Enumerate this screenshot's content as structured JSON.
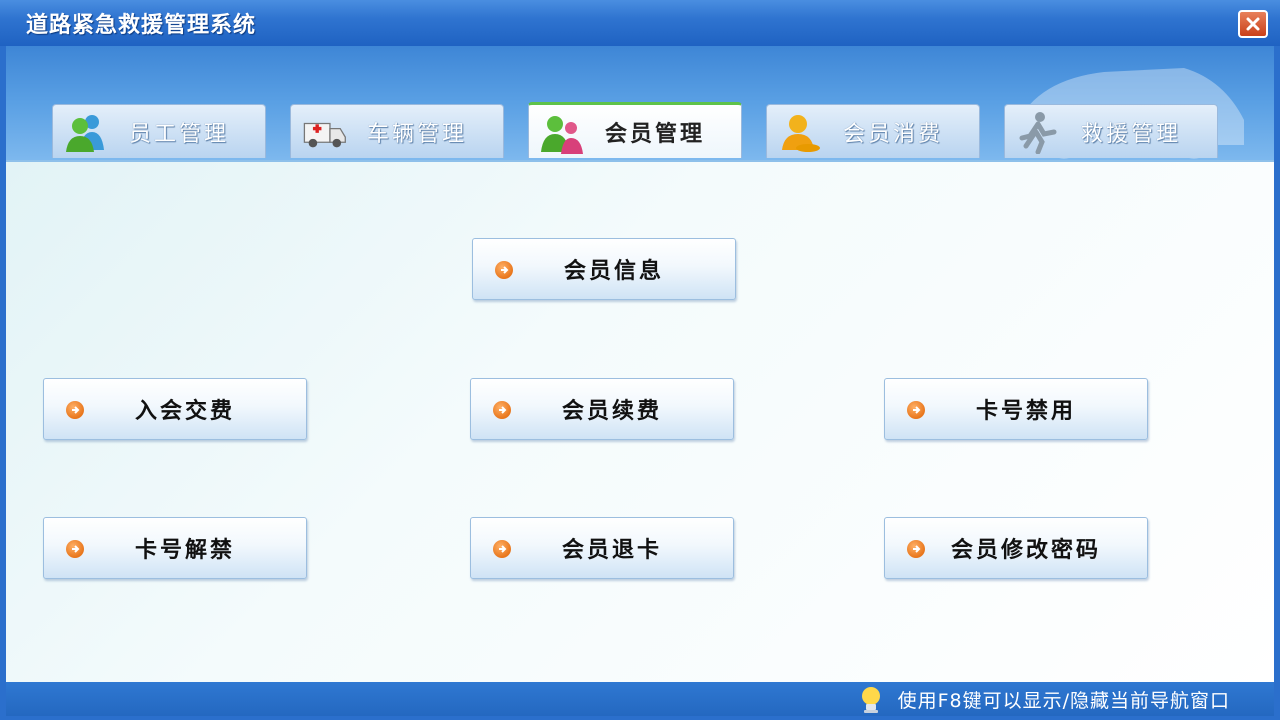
{
  "window": {
    "title": "道路紧急救援管理系统"
  },
  "tabs": [
    {
      "label": "员工管理",
      "icon": "users-icon",
      "active": false
    },
    {
      "label": "车辆管理",
      "icon": "ambulance-icon",
      "active": false
    },
    {
      "label": "会员管理",
      "icon": "members-icon",
      "active": true
    },
    {
      "label": "会员消费",
      "icon": "member-consume-icon",
      "active": false
    },
    {
      "label": "救援管理",
      "icon": "running-man-icon",
      "active": false
    }
  ],
  "buttons": {
    "member_info": "会员信息",
    "join_fee": "入会交费",
    "member_renew": "会员续费",
    "card_disable": "卡号禁用",
    "card_unban": "卡号解禁",
    "member_cancel": "会员退卡",
    "member_password": "会员修改密码"
  },
  "statusbar": {
    "hint": "使用F8键可以显示/隐藏当前导航窗口",
    "icon": "lightbulb-icon"
  },
  "colors": {
    "titlebar": "#2f74d0",
    "active_tab_accent": "#5fc24a",
    "arrow": "#e8761c",
    "close": "#c9401a"
  }
}
